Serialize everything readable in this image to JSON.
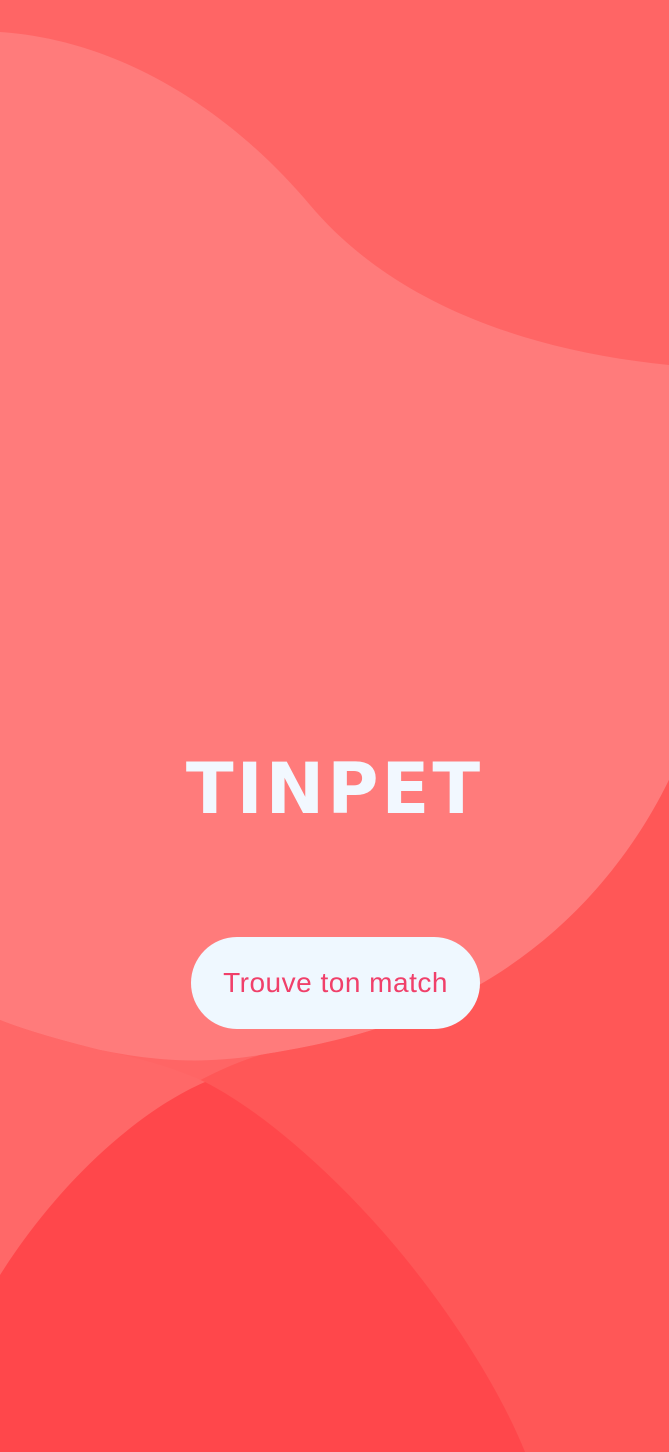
{
  "app": {
    "logo_text": "TINPET"
  },
  "cta": {
    "label": "Trouve ton match"
  },
  "colors": {
    "background_top": "#ff6565",
    "blob_light": "#ff7b7b",
    "blob_mid": "#ff5757",
    "blob_dark": "#ff474b",
    "logo": "#f2f8ff",
    "button_bg": "#eff8ff",
    "button_text": "#f0406a"
  }
}
